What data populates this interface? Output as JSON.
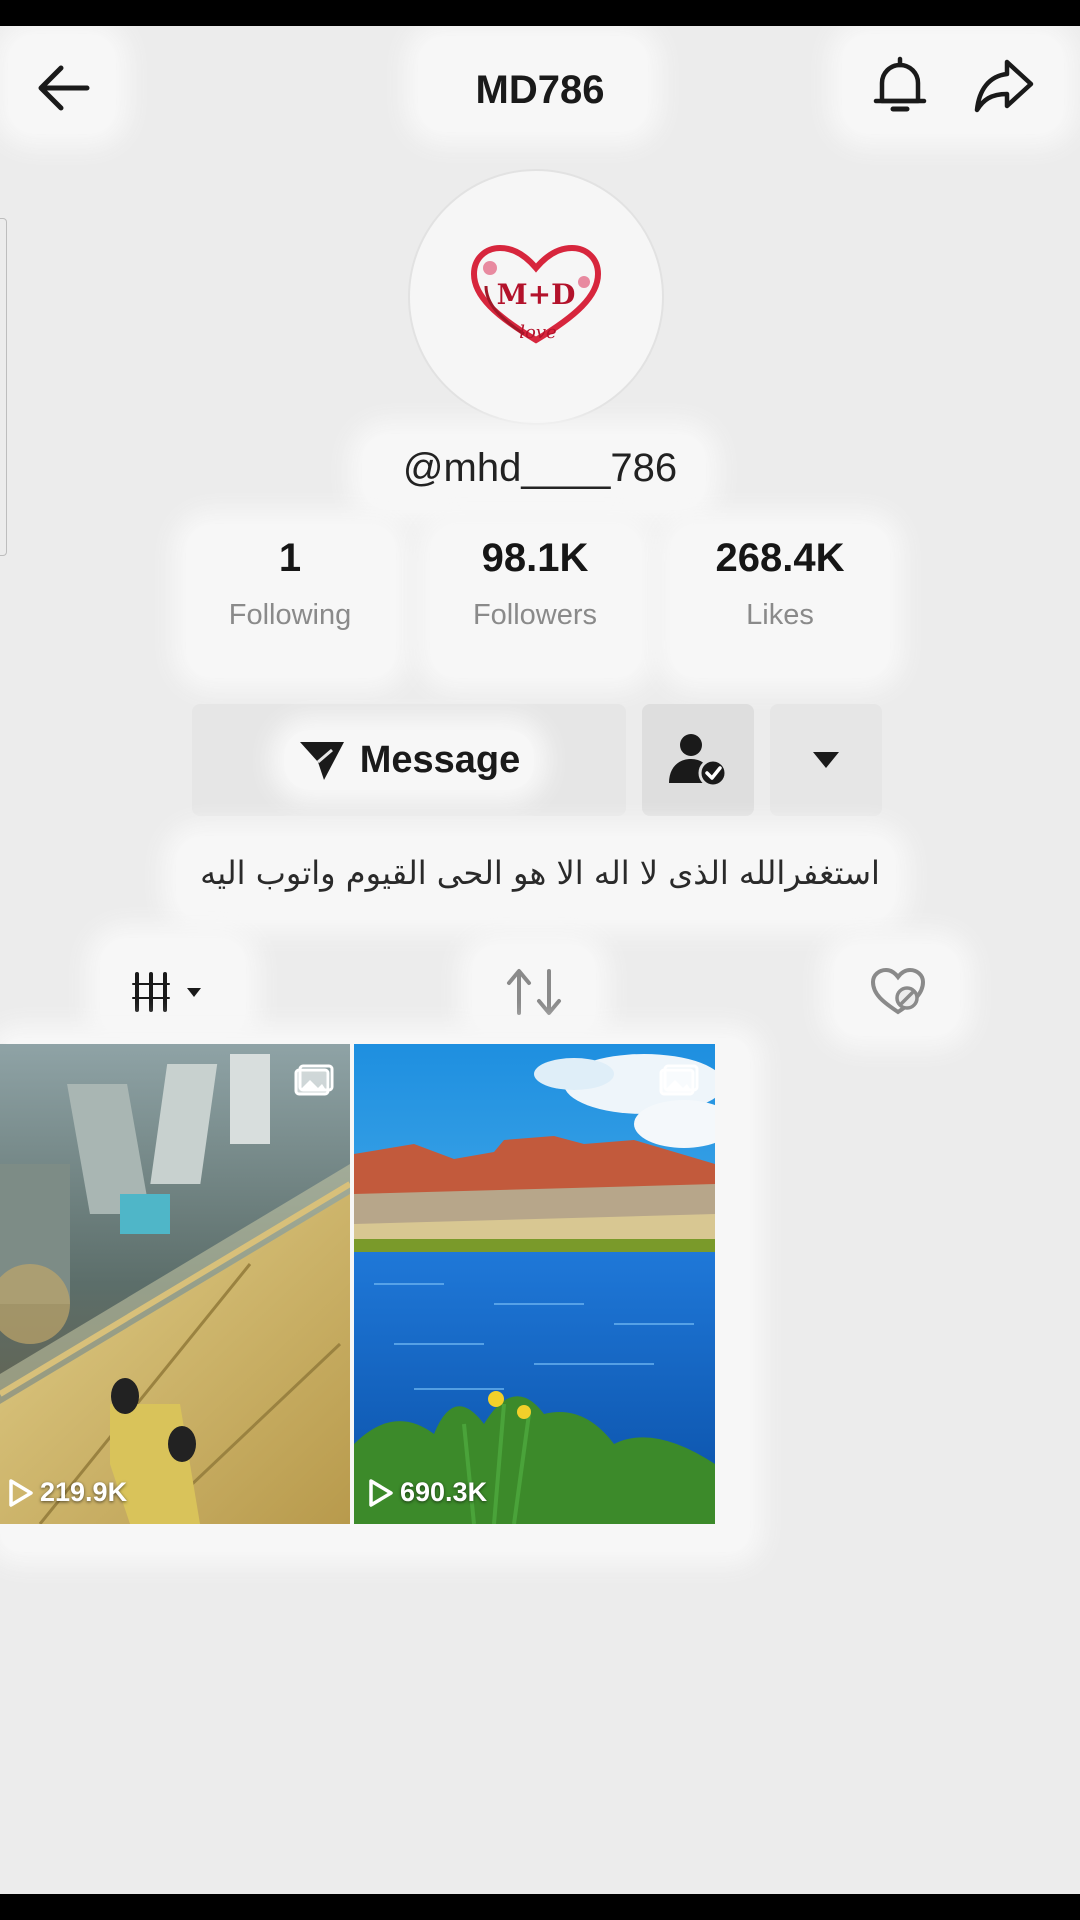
{
  "header": {
    "title": "MD786",
    "back_icon": "arrow-left-icon",
    "bell_icon": "bell-icon",
    "share_icon": "share-icon"
  },
  "profile": {
    "avatar_text": "M+D",
    "avatar_script": "love",
    "username": "@mhd____786",
    "stats": [
      {
        "value": "1",
        "label": "Following"
      },
      {
        "value": "98.1K",
        "label": "Followers"
      },
      {
        "value": "268.4K",
        "label": "Likes"
      }
    ],
    "bio": "استغفرالله الذى لا اله الا هو الحى القيوم واتوب اليه"
  },
  "actions": {
    "message_label": "Message",
    "friend_icon": "user-check-icon",
    "more_icon": "caret-down-icon"
  },
  "tabs": [
    {
      "name": "videos",
      "icon": "grid-icon",
      "active": true
    },
    {
      "name": "reposts",
      "icon": "repost-icon",
      "active": false
    },
    {
      "name": "liked",
      "icon": "liked-hidden-icon",
      "active": false
    }
  ],
  "videos": [
    {
      "views": "219.9K",
      "subject": "city-skyscraper-view"
    },
    {
      "views": "690.3K",
      "subject": "lake-and-cliffs"
    }
  ],
  "colors": {
    "background": "#ececec",
    "accent_heart": "#d7263d",
    "text_primary": "#161616",
    "text_secondary": "#8a8a8a"
  }
}
